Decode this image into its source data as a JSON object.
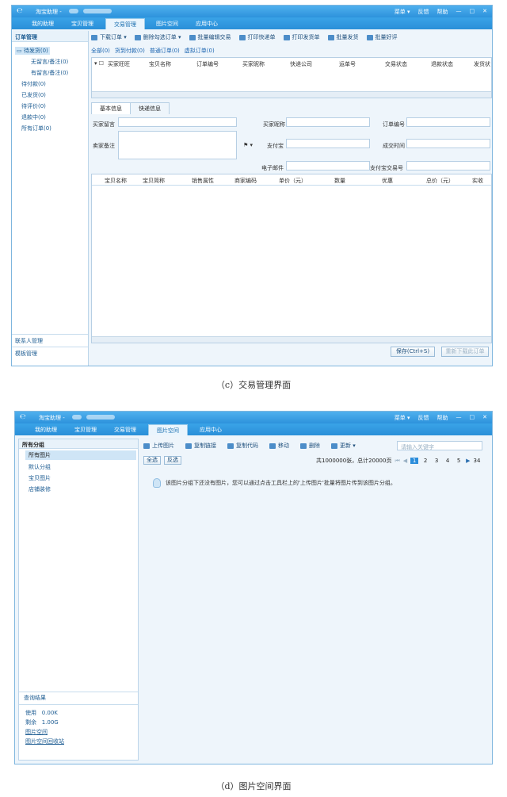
{
  "panel_c": {
    "titlebar": {
      "logo": "℮",
      "app_name": "淘宝助理 -",
      "menu": [
        "菜单 ▾",
        "反馈",
        "帮助"
      ],
      "controls": [
        "—",
        "□",
        "✕"
      ]
    },
    "nav_tabs": [
      "我的助理",
      "宝贝管理",
      "交易管理",
      "图片空间",
      "应用中心"
    ],
    "sidebar": {
      "header": "订单管理",
      "items": [
        "待发货(0)",
        "无留言/备注(0)",
        "有留言/备注(0)",
        "待付款(0)",
        "已发货(0)",
        "待评价(0)",
        "退款中(0)",
        "所有订单(0)"
      ],
      "bottom": [
        "联系人管理",
        "模板管理"
      ]
    },
    "toolbar": [
      "下载订单 ▾",
      "删除勾选订单 ▾",
      "批量编辑交易",
      "打印快递单",
      "打印发货单",
      "批量发货",
      "批量好评"
    ],
    "filters": [
      "全部(0)",
      "货到付款(0)",
      "普通订单(0)",
      "虚拟订单(0)"
    ],
    "columns": [
      "买家旺旺",
      "宝贝名称",
      "订单编号",
      "买家昵称",
      "快递公司",
      "运单号",
      "交易状态",
      "退款状态",
      "发货状"
    ],
    "detail_tabs": [
      "基本信息",
      "快递信息"
    ],
    "form": {
      "buyer_message": "买家留言",
      "buyer_nick": "买家昵称",
      "order_no": "订单编号",
      "buyer_note": "卖家备注",
      "alipay": "支付宝",
      "deal_time": "成交时间",
      "email": "电子邮件",
      "alipay_trade": "支付宝交易号",
      "flag": "⚑ ▾"
    },
    "item_columns": [
      "宝贝名称",
      "宝贝简称",
      "销售属性",
      "商家编码",
      "单价（元）",
      "数量",
      "优惠",
      "总价（元）",
      "实收"
    ],
    "save_button": "保存(Ctrl+S)",
    "redownload_button": "重新下载此订单"
  },
  "caption_c": "（c）交易管理界面",
  "panel_d": {
    "titlebar": {
      "logo": "℮",
      "app_name": "淘宝助理 -",
      "menu": [
        "菜单 ▾",
        "反馈",
        "帮助"
      ],
      "controls": [
        "—",
        "□",
        "✕"
      ]
    },
    "nav_tabs": [
      "我的助理",
      "宝贝管理",
      "交易管理",
      "图片空间",
      "应用中心"
    ],
    "sidebar": {
      "header": "所有分组",
      "items": [
        "所有图片",
        "默认分组",
        "宝贝图片",
        "店铺装修"
      ],
      "query": "查询结果",
      "usage_label": "使用",
      "usage_value": "0.00K",
      "remain_label": "剩余",
      "remain_value": "1.00G",
      "links": [
        "图片空间",
        "图片空间回收站"
      ]
    },
    "toolbar": [
      "上传图片",
      "复制链接",
      "复制代码",
      "移动",
      "删除",
      "更新 ▾"
    ],
    "search_placeholder": "请输入关键字",
    "select_all": "全选",
    "invert": "反选",
    "stats": "共1000000张，总计20000页",
    "pages": [
      "1",
      "2",
      "3",
      "4",
      "5"
    ],
    "last_page": "34",
    "empty_message": "该图片分组下还没有图片，您可以通过点击工具栏上的'上传图片'批量将图片传到该图片分组。"
  },
  "caption_d": "（d）图片空间界面"
}
